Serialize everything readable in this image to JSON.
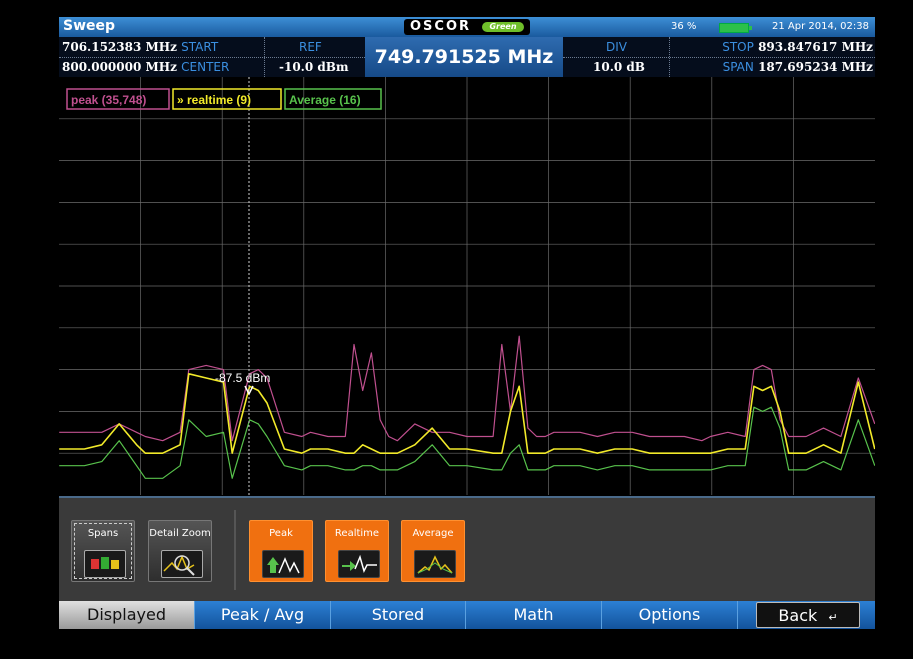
{
  "title_bar": {
    "app_title": "Sweep",
    "logo_text": "OSCOR",
    "logo_badge": "Green",
    "battery": "36 %",
    "datetime": "21 Apr 2014, 02:38"
  },
  "info_bar": {
    "start_value": "706.152383 MHz",
    "start_label": "START",
    "center_value": "800.000000 MHz",
    "center_label": "CENTER",
    "ref_label": "REF",
    "ref_value": "-10.0 dBm",
    "marker_frequency": "749.791525 MHz",
    "div_label": "DIV",
    "div_value": "10.0 dB",
    "stop_label": "STOP",
    "stop_value": "893.847617 MHz",
    "span_label": "SPAN",
    "span_value": "187.695234 MHz"
  },
  "legend": {
    "peak": "peak (35,748)",
    "realtime": "» realtime (9)",
    "average": "Average (16)"
  },
  "marker": {
    "label": "-87.5 dBm"
  },
  "colors": {
    "peak": "#c0508f",
    "realtime": "#f2ea2a",
    "average": "#58c24c",
    "grid": "#6a6a6a",
    "accent_orange": "#f07010",
    "tab_blue": "#1f6dbd"
  },
  "toolbar": {
    "buttons": [
      {
        "label": "Spans",
        "icon": "spans-icon",
        "selected": true
      },
      {
        "label": "Detail Zoom",
        "icon": "zoom-icon",
        "selected": false
      },
      {
        "label": "Peak",
        "icon": "peak-trace-icon",
        "selected": false
      },
      {
        "label": "Realtime",
        "icon": "realtime-trace-icon",
        "selected": false
      },
      {
        "label": "Average",
        "icon": "average-trace-icon",
        "selected": false
      }
    ]
  },
  "tabs": [
    {
      "label": "Displayed",
      "active": true
    },
    {
      "label": "Peak / Avg",
      "active": false
    },
    {
      "label": "Stored",
      "active": false
    },
    {
      "label": "Math",
      "active": false
    },
    {
      "label": "Options",
      "active": false
    },
    {
      "label": "Back",
      "active": false
    }
  ],
  "chart_data": {
    "type": "line",
    "x_unit": "MHz",
    "y_unit": "dBm",
    "xlim": [
      706.152383,
      893.847617
    ],
    "ylim": [
      -110,
      -10
    ],
    "grid": true,
    "legend_position": "top-left",
    "marker": {
      "x": 749.79,
      "y": -87.5
    },
    "series": [
      {
        "name": "peak (35,748)",
        "color": "#c0508f",
        "x": [
          706.2,
          712,
          716,
          720,
          724,
          726,
          730,
          734,
          736,
          740,
          744,
          746,
          750,
          752,
          754,
          758,
          762,
          764,
          768,
          772,
          774,
          776,
          778,
          780,
          782,
          784,
          788,
          792,
          796,
          800,
          806,
          808,
          810,
          812,
          814,
          816,
          818,
          820,
          822,
          826,
          830,
          834,
          838,
          842,
          846,
          850,
          854,
          856,
          860,
          864,
          866,
          868,
          870,
          872,
          874,
          878,
          882,
          886,
          890,
          893.8
        ],
        "y": [
          -95,
          -95,
          -95,
          -93,
          -95,
          -96,
          -97,
          -95,
          -80,
          -79,
          -80,
          -97,
          -81,
          -80,
          -82,
          -95,
          -96,
          -95,
          -96,
          -96,
          -74,
          -85,
          -76,
          -92,
          -96,
          -97,
          -93,
          -95,
          -95,
          -96,
          -96,
          -74,
          -90,
          -72,
          -94,
          -96,
          -96,
          -95,
          -95,
          -95,
          -96,
          -95,
          -95,
          -96,
          -96,
          -96,
          -97,
          -96,
          -95,
          -96,
          -80,
          -79,
          -80,
          -92,
          -96,
          -96,
          -94,
          -96,
          -82,
          -93
        ]
      },
      {
        "name": "» realtime (9)",
        "color": "#f2ea2a",
        "x": [
          706.2,
          712,
          716,
          720,
          724,
          726,
          730,
          734,
          736,
          740,
          744,
          746,
          750,
          752,
          754,
          758,
          762,
          764,
          768,
          772,
          774,
          776,
          778,
          780,
          782,
          784,
          788,
          792,
          796,
          800,
          806,
          808,
          810,
          812,
          814,
          816,
          818,
          820,
          822,
          826,
          830,
          834,
          838,
          842,
          846,
          850,
          854,
          856,
          860,
          864,
          866,
          868,
          870,
          872,
          874,
          878,
          882,
          886,
          890,
          893.8
        ],
        "y": [
          -99,
          -99,
          -98,
          -93,
          -98,
          -100,
          -100,
          -98,
          -81,
          -82,
          -83,
          -100,
          -84,
          -85,
          -88,
          -99,
          -100,
          -99,
          -99,
          -100,
          -100,
          -98,
          -99,
          -100,
          -100,
          -100,
          -98,
          -94,
          -99,
          -99,
          -100,
          -100,
          -90,
          -84,
          -100,
          -100,
          -100,
          -99,
          -99,
          -99,
          -100,
          -99,
          -99,
          -100,
          -100,
          -100,
          -100,
          -100,
          -99,
          -99,
          -84,
          -85,
          -84,
          -90,
          -100,
          -100,
          -98,
          -100,
          -83,
          -99
        ]
      },
      {
        "name": "Average (16)",
        "color": "#58c24c",
        "x": [
          706.2,
          712,
          716,
          720,
          724,
          726,
          730,
          734,
          736,
          740,
          744,
          746,
          750,
          752,
          754,
          758,
          762,
          764,
          768,
          772,
          774,
          776,
          778,
          780,
          782,
          784,
          788,
          792,
          796,
          800,
          806,
          808,
          810,
          812,
          814,
          816,
          818,
          820,
          822,
          826,
          830,
          834,
          838,
          842,
          846,
          850,
          854,
          856,
          860,
          864,
          866,
          868,
          870,
          872,
          874,
          878,
          882,
          886,
          890,
          893.8
        ],
        "y": [
          -103,
          -103,
          -102,
          -97,
          -103,
          -106,
          -106,
          -103,
          -92,
          -96,
          -95,
          -106,
          -92,
          -93,
          -96,
          -103,
          -104,
          -103,
          -103,
          -104,
          -104,
          -103,
          -103,
          -104,
          -104,
          -104,
          -102,
          -98,
          -103,
          -103,
          -104,
          -104,
          -100,
          -98,
          -104,
          -104,
          -104,
          -103,
          -103,
          -103,
          -104,
          -103,
          -103,
          -104,
          -104,
          -104,
          -104,
          -104,
          -103,
          -103,
          -89,
          -90,
          -89,
          -94,
          -104,
          -104,
          -102,
          -104,
          -92,
          -103
        ]
      }
    ]
  }
}
